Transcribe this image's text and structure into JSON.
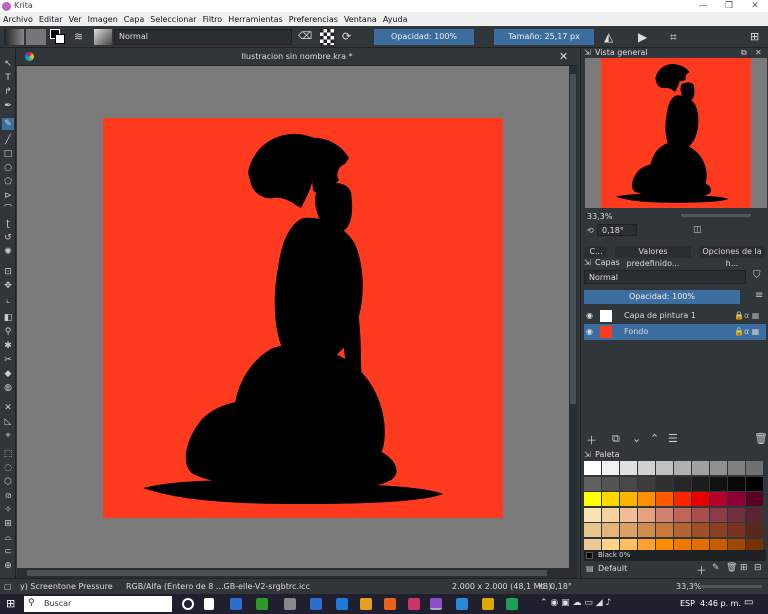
{
  "window": {
    "title": "Krita",
    "controls": [
      "—",
      "❐",
      "✕"
    ]
  },
  "menu": [
    "Archivo",
    "Editar",
    "Ver",
    "Imagen",
    "Capa",
    "Seleccionar",
    "Filtro",
    "Herramientas",
    "Preferencias",
    "Ventana",
    "Ayuda"
  ],
  "toolbar": {
    "blend_mode": "Normal",
    "opacity": "Opacidad: 100%",
    "size": "Tamaño: 25,17 px"
  },
  "document": {
    "tab_title": "Ilustracion sin nombre.kra *"
  },
  "overview": {
    "title": "Vista general",
    "zoom": "33,3%",
    "rotation": "0,18°"
  },
  "tabs": [
    "C...",
    "Valores predefinido...",
    "Opciones de la h..."
  ],
  "layers": {
    "title": "Capas",
    "blend": "Normal",
    "opacity": "Opacidad:  100%",
    "items": [
      {
        "name": "Capa de pintura 1",
        "selected": false
      },
      {
        "name": "Fondo",
        "selected": true
      }
    ]
  },
  "palette": {
    "title": "Paleta",
    "selected_color": "Black 0%",
    "footer_label": "Default",
    "rows": [
      [
        "#ffffff",
        "#f2f2f2",
        "#e0e0e0",
        "#d0d0d0",
        "#c0c0c0",
        "#b0b0b0",
        "#a0a0a0",
        "#909090",
        "#808080",
        "#707070"
      ],
      [
        "#606060",
        "#545454",
        "#484848",
        "#3c3c3c",
        "#303030",
        "#262626",
        "#1c1c1c",
        "#121212",
        "#080808",
        "#000000"
      ],
      [
        "#ffff00",
        "#ffd800",
        "#ffb400",
        "#ff9000",
        "#ff5a00",
        "#ff2400",
        "#e60000",
        "#b4002a",
        "#8c0035",
        "#5a0024"
      ],
      [
        "#f5e6b4",
        "#f5d2a0",
        "#f0be96",
        "#e6a082",
        "#d2826e",
        "#c0645a",
        "#a84e4e",
        "#8c3c46",
        "#70303c",
        "#5a2432"
      ],
      [
        "#e6c88c",
        "#e6b478",
        "#dca064",
        "#d28c50",
        "#c8783c",
        "#b46432",
        "#a05028",
        "#8c4023",
        "#78321e",
        "#5a2819"
      ],
      [
        "#ebc896",
        "#ffd28c",
        "#ffbe64",
        "#ffa032",
        "#ff8c00",
        "#f07800",
        "#e66e00",
        "#c85a00",
        "#a04600",
        "#783200"
      ]
    ]
  },
  "status": {
    "brush": "y) Screentone Pressure",
    "color_profile": "RGB/Alfa (Entero de 8 ...GB-elle-V2-srgbtrc.icc",
    "doc_size": "2.000 x 2.000 (48,1 MiB)",
    "rotation": "0,18°",
    "zoom": "33,3%"
  },
  "taskbar": {
    "search_placeholder": "Buscar",
    "lang": "ESP",
    "time": "4:46 p. m."
  },
  "colors": {
    "canvas_red": "#ff3a1f",
    "accent": "#3d6ea0",
    "panel_bg": "#31363b"
  }
}
